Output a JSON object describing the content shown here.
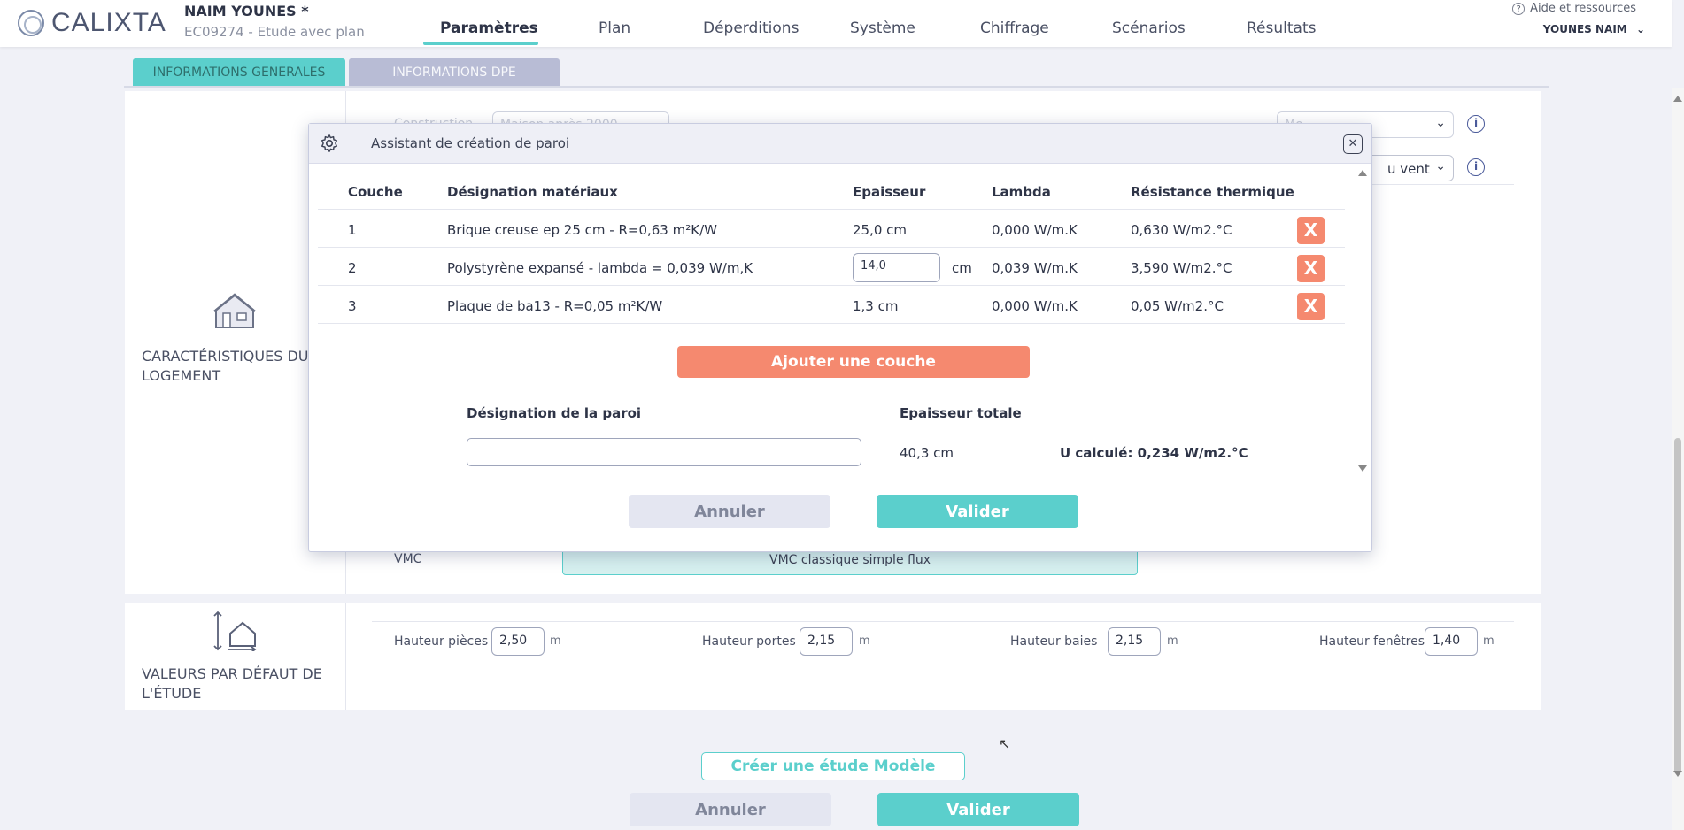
{
  "header": {
    "logo_text": "CALIXTA",
    "user_name": "NAIM YOUNES *",
    "study_id": "EC09274 - Etude avec plan",
    "nav": [
      "Paramètres",
      "Plan",
      "Déperditions",
      "Système",
      "Chiffrage",
      "Scénarios",
      "Résultats"
    ],
    "active_nav": "Paramètres",
    "help_label": "Aide et ressources",
    "account_label": "YOUNES NAIM"
  },
  "tabs": {
    "general": "INFORMATIONS GENERALES",
    "dpe": "INFORMATIONS DPE"
  },
  "housing": {
    "section_label": "CARACTÉRISTIQUES DU LOGEMENT",
    "faded_field_1": "Construction",
    "faded_field_1_value": "Maison après 2000",
    "faded_field_2_value": "Mo",
    "faded_field_3_value": "u vent",
    "vmc_label": "VMC",
    "vmc_value": "VMC classique simple flux"
  },
  "defaults": {
    "section_label": "VALEURS PAR DÉFAUT DE L'ÉTUDE",
    "fields": [
      {
        "label": "Hauteur pièces",
        "value": "2,50",
        "unit": "m"
      },
      {
        "label": "Hauteur portes",
        "value": "2,15",
        "unit": "m"
      },
      {
        "label": "Hauteur baies",
        "value": "2,15",
        "unit": "m"
      },
      {
        "label": "Hauteur fenêtres",
        "value": "1,40",
        "unit": "m"
      }
    ]
  },
  "modal": {
    "title": "Assistant de création de paroi",
    "columns": [
      "Couche",
      "Désignation matériaux",
      "Epaisseur",
      "Lambda",
      "Résistance thermique"
    ],
    "rows": [
      {
        "couche": "1",
        "designation": "Brique creuse ep 25 cm - R=0,63 m²K/W",
        "epaisseur": "25,0 cm",
        "lambda": "0,000 W/m.K",
        "resistance": "0,630 W/m2.°C"
      },
      {
        "couche": "2",
        "designation": "Polystyrène expansé - lambda = 0,039 W/m,K",
        "epaisseur": "14,0",
        "epaisseur_unit": "cm",
        "lambda": "0,039 W/m.K",
        "resistance": "3,590 W/m2.°C"
      },
      {
        "couche": "3",
        "designation": "Plaque de ba13 - R=0,05 m²K/W",
        "epaisseur": "1,3 cm",
        "lambda": "0,000 W/m.K",
        "resistance": "0,05 W/m2.°C"
      }
    ],
    "delete_label": "X",
    "add_layer": "Ajouter une couche",
    "wall_name_label": "Désignation de la paroi",
    "wall_name_value": "",
    "total_thickness_label": "Epaisseur totale",
    "total_thickness_value": "40,3 cm",
    "u_value": "U calculé: 0,234 W/m2.°C",
    "cancel": "Annuler",
    "validate": "Valider"
  },
  "footer": {
    "create_model": "Créer une étude Modèle",
    "cancel": "Annuler",
    "validate": "Valider"
  },
  "colors": {
    "accent": "#5bcfcc",
    "danger": "#f5896f",
    "tab_inactive": "#b8bcd5"
  }
}
